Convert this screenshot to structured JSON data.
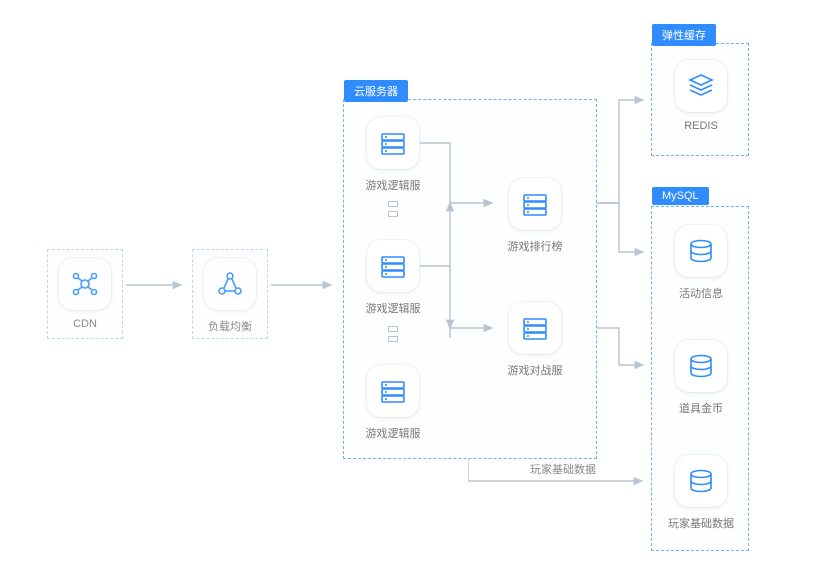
{
  "nodes": {
    "cdn": "CDN",
    "lb": "负载均衡",
    "logic1": "游戏逻辑服",
    "logic2": "游戏逻辑服",
    "logic3": "游戏逻辑服",
    "rank": "游戏排行榜",
    "battle": "游戏对战服",
    "redis": "REDIS",
    "activity": "活动信息",
    "item": "道具金币",
    "player": "玩家基础数据"
  },
  "groups": {
    "cloud": "云服务器",
    "cache": "弹性缓存",
    "mysql": "MySQL"
  },
  "flows": {
    "player_data": "玩家基础数据"
  }
}
